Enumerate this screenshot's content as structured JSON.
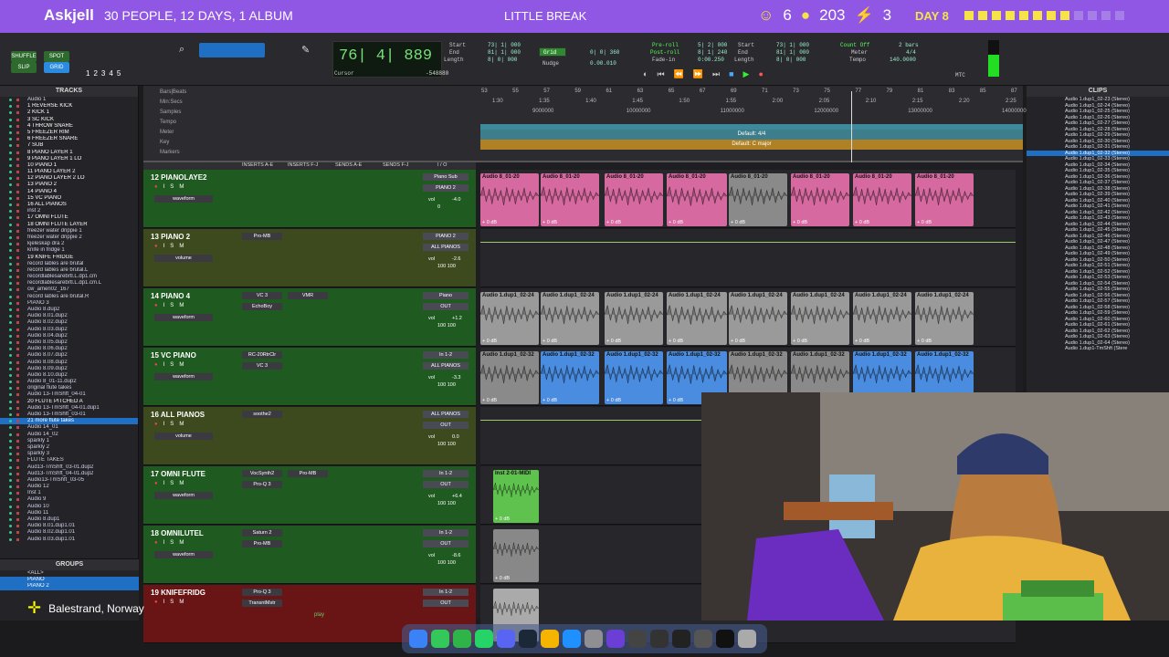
{
  "banner": {
    "name": "Askjell",
    "subtitle": "30 PEOPLE, 12 DAYS, 1 ALBUM",
    "center": "LITTLE BREAK",
    "stat1": "6",
    "stat2": "203",
    "stat3": "3",
    "day": "DAY 8",
    "dots_on": 8,
    "dots_total": 12,
    "colors": {
      "bg": "#8f57e4",
      "accent": "#f6e34a"
    }
  },
  "transport": {
    "counter_main": "76| 4| 889",
    "cursor_label": "Cursor",
    "cursor_value": "-548880",
    "start_label": "Start",
    "end_label": "End",
    "length_label": "Length",
    "start": "73| 1| 000",
    "end": "81| 1| 000",
    "length": "8| 0| 000",
    "grid_label": "Grid",
    "grid_value": "0| 0| 360",
    "nudge_label": "Nudge",
    "nudge_value": "0.00.010",
    "preroll_label": "Pre-roll",
    "postroll_label": "Post-roll",
    "fadein_label": "Fade-in",
    "preroll": "5| 2| 000",
    "postroll": "8| 1| 240",
    "fadein": "0:00.250",
    "start2": "73| 1| 000",
    "end2": "81| 1| 000",
    "length2": "8| 0| 000",
    "countoff_label": "Count Off",
    "countoff": "2 bars",
    "meter_label": "Meter",
    "meter": "4/4",
    "tempo_label": "Tempo",
    "tempo": "140.0000",
    "mtc": "MTC",
    "mode_buttons": [
      "SHUFFLE",
      "SPOT",
      "SLIP",
      "GRID"
    ],
    "zoom_numbers": [
      "1",
      "2",
      "3",
      "4",
      "5"
    ]
  },
  "tracks_panel": {
    "title": "TRACKS",
    "items": [
      "Audio 1",
      "1 REVERSE KICK",
      "2 KICK 1",
      "3 SC KICK",
      "4 THROW SNARE",
      "5 FREEZER RIM",
      "6 FREEZER SNARE",
      "7 SUB",
      "8 PIANO LAYER 1",
      "9 PIANO LAYER 1 LO",
      "10 PIANO 1",
      "11 PIANO LAYER 2",
      "12 PIANO LAYER 2 LO",
      "13 PIANO 2",
      "14 PIANO 4",
      "15 VC PIANO",
      "16 ALL PIANOS",
      "inst 2",
      "17 OMNI FLUTE",
      "18 OMNI FLUTE LAYER",
      "freezer water drippie 1",
      "freezer water drippie 2",
      "kjeleskap dra 2",
      "knife in fridge 1",
      "19 KNIFE FRIDGE",
      "record lables are brutal",
      "record lables are brutal.L",
      "recordlablesarebrtl.L.dp1.cm",
      "recordlablesarebrtl.L.dp1.cm.L",
      "cw_amen02_167",
      "record lables are brutal.R",
      "PIANO 3",
      "Audio 8.dup2",
      "Audio 8.01.dup2",
      "Audio 8.02.dup2",
      "Audio 8.03.dup2",
      "Audio 8.04.dup2",
      "Audio 8.05.dup2",
      "Audio 8.06.dup2",
      "Audio 8.07.dup2",
      "Audio 8.08.dup2",
      "Audio 8.09.dup2",
      "Audio 8.10.dup2",
      "Audio 8_01-11.dup2",
      "original flute takes",
      "Audio 13-TmShft_04-01",
      "20 FLUTE PITCHED A",
      "Audio 13-TmShft_04-01.dup1",
      "Audio 13-TmShft_03-01",
      "21 more flute takes",
      "Audio 14_01",
      "Audio 14_02",
      "sparkly 1",
      "sparkly 2",
      "sparkly 3",
      "FLUTE TAKES",
      "Aud13-TmShft_03-01.dup2",
      "Aud13-TmShft_04-01.dup2",
      "Audio13-TmShft_03-05",
      "Audio 12",
      "Inst 1",
      "Audio 9",
      "Audio 10",
      "Audio 11",
      "Audio 8.dup1",
      "Audio 8.01.dup1.01",
      "Audio 8.02.dup1.01",
      "Audio 8.03.dup1.01"
    ],
    "selected_index": 49
  },
  "groups_panel": {
    "title": "GROUPS",
    "items": [
      "<ALL>",
      "PIANO",
      "PIANO 2"
    ]
  },
  "ruler": {
    "labels": [
      "Bars|Beats",
      "Min:Secs",
      "Samples",
      "Tempo",
      "Meter",
      "Key",
      "Markers"
    ],
    "bars": [
      "53",
      "55",
      "57",
      "59",
      "61",
      "63",
      "65",
      "67",
      "69",
      "71",
      "73",
      "75",
      "77",
      "79",
      "81",
      "83",
      "85",
      "87"
    ],
    "mins": [
      "1:30",
      "1:35",
      "1:40",
      "1:45",
      "1:50",
      "1:55",
      "2:00",
      "2:05",
      "2:10",
      "2:15",
      "2:20",
      "2:25"
    ],
    "samples": [
      "9000000",
      "10000000",
      "11000000",
      "12000000",
      "13000000",
      "14000000"
    ],
    "meter_default": "Default: 4/4",
    "key_default": "Default: C major"
  },
  "mix_headers": [
    "INSERTS A-E",
    "INSERTS F-J",
    "SENDS A-E",
    "SENDS F-J",
    "I / O"
  ],
  "channels": [
    {
      "name": "12 PIANOLAYE2",
      "color": "#1f5a21",
      "inserts": [],
      "io_in": "Piano Sub",
      "io_out": "PIANO 2",
      "view": "waveform",
      "vol": "-4.0",
      "pan": "0",
      "clip": "Audio 8_01-20",
      "clipcolor": "#d66aa0"
    },
    {
      "name": "13   PIANO 2",
      "color": "#3c4a1e",
      "inserts": [
        "Pro-MB"
      ],
      "io_in": "PIANO 2",
      "io_out": "ALL PIANOS",
      "view": "volume",
      "vol": "-2.6",
      "pan": "100  100",
      "clip": "",
      "clipcolor": ""
    },
    {
      "name": "14   PIANO 4",
      "color": "#1f5a21",
      "inserts": [
        "VC 3",
        "EchoBoy",
        "VMR"
      ],
      "io_in": "Piano",
      "io_out": "OUT",
      "view": "waveform",
      "vol": "+1.2",
      "pan": "100  100",
      "clip": "Audio 1.dup1_02-24",
      "clipcolor": "#9a9a9a"
    },
    {
      "name": "15   VC PIANO",
      "color": "#1f5a21",
      "inserts": [
        "RC-20RtrClr",
        "VC 3"
      ],
      "io_in": "In 1-2",
      "io_out": "ALL PIANOS",
      "view": "waveform",
      "vol": "-3.3",
      "pan": "100  100",
      "clip": "Audio 1.dup1_02-32",
      "clipcolor": "#4a8de0"
    },
    {
      "name": "16   ALL PIANOS",
      "color": "#3c4a1e",
      "inserts": [
        "soothe2"
      ],
      "io_in": "ALL PIANOS",
      "io_out": "OUT",
      "view": "volume",
      "vol": "0.0",
      "pan": "100  100",
      "clip": "",
      "clipcolor": ""
    },
    {
      "name": "17   OMNI FLUTE",
      "color": "#1f5a21",
      "inserts": [
        "VocSynth2",
        "Pro-Q 3",
        "Pro-MB"
      ],
      "io_in": "In 1-2",
      "io_out": "OUT",
      "view": "waveform",
      "vol": "+6.4",
      "pan": "100  100",
      "clip": "Inst 2-01-MIDI",
      "clipcolor": "#5fc24f"
    },
    {
      "name": "18   OMNILUTEL",
      "color": "#1f5a21",
      "inserts": [
        "Saturn 2",
        "Pro-MB"
      ],
      "io_in": "In 1-2",
      "io_out": "OUT",
      "view": "waveform",
      "vol": "-8.6",
      "pan": "100  100",
      "clip": "",
      "clipcolor": "#888"
    },
    {
      "name": "19   KNIFEFRIDG",
      "color": "#6a1515",
      "inserts": [
        "Pro-Q 3",
        "TransntMstr"
      ],
      "io_in": "In 1-2",
      "io_out": "OUT",
      "view": "",
      "vol": "",
      "pan": "",
      "clip": "",
      "clipcolor": "#aaa"
    }
  ],
  "clips_panel": {
    "title": "CLIPS",
    "items": [
      "Audio 1.dup1_02-23 (Stereo)",
      "Audio 1.dup1_02-24 (Stereo)",
      "Audio 1.dup1_02-25 (Stereo)",
      "Audio 1.dup1_02-26 (Stereo)",
      "Audio 1.dup1_02-27 (Stereo)",
      "Audio 1.dup1_02-28 (Stereo)",
      "Audio 1.dup1_02-29 (Stereo)",
      "Audio 1.dup1_02-30 (Stereo)",
      "Audio 1.dup1_02-31 (Stereo)",
      "Audio 1.dup1_02-32 (Stereo)",
      "Audio 1.dup1_02-33 (Stereo)",
      "Audio 1.dup1_02-34 (Stereo)",
      "Audio 1.dup1_02-35 (Stereo)",
      "Audio 1.dup1_02-36 (Stereo)",
      "Audio 1.dup1_02-37 (Stereo)",
      "Audio 1.dup1_02-38 (Stereo)",
      "Audio 1.dup1_02-39 (Stereo)",
      "Audio 1.dup1_02-40 (Stereo)",
      "Audio 1.dup1_02-41 (Stereo)",
      "Audio 1.dup1_02-42 (Stereo)",
      "Audio 1.dup1_02-43 (Stereo)",
      "Audio 1.dup1_02-44 (Stereo)",
      "Audio 1.dup1_02-45 (Stereo)",
      "Audio 1.dup1_02-46 (Stereo)",
      "Audio 1.dup1_02-47 (Stereo)",
      "Audio 1.dup1_02-48 (Stereo)",
      "Audio 1.dup1_02-49 (Stereo)",
      "Audio 1.dup1_02-50 (Stereo)",
      "Audio 1.dup1_02-51 (Stereo)",
      "Audio 1.dup1_02-52 (Stereo)",
      "Audio 1.dup1_02-53 (Stereo)",
      "Audio 1.dup1_02-54 (Stereo)",
      "Audio 1.dup1_02-55 (Stereo)",
      "Audio 1.dup1_02-56 (Stereo)",
      "Audio 1.dup1_02-57 (Stereo)",
      "Audio 1.dup1_02-58 (Stereo)",
      "Audio 1.dup1_02-59 (Stereo)",
      "Audio 1.dup1_02-60 (Stereo)",
      "Audio 1.dup1_02-61 (Stereo)",
      "Audio 1.dup1_02-62 (Stereo)",
      "Audio 1.dup1_02-63 (Stereo)",
      "Audio 1.dup1_02-64 (Stereo)",
      "Audio 1.dup1-TmShft (Stere"
    ],
    "selected_index": 9
  },
  "location": "Balestrand, Norway",
  "edit_bottom": "play"
}
